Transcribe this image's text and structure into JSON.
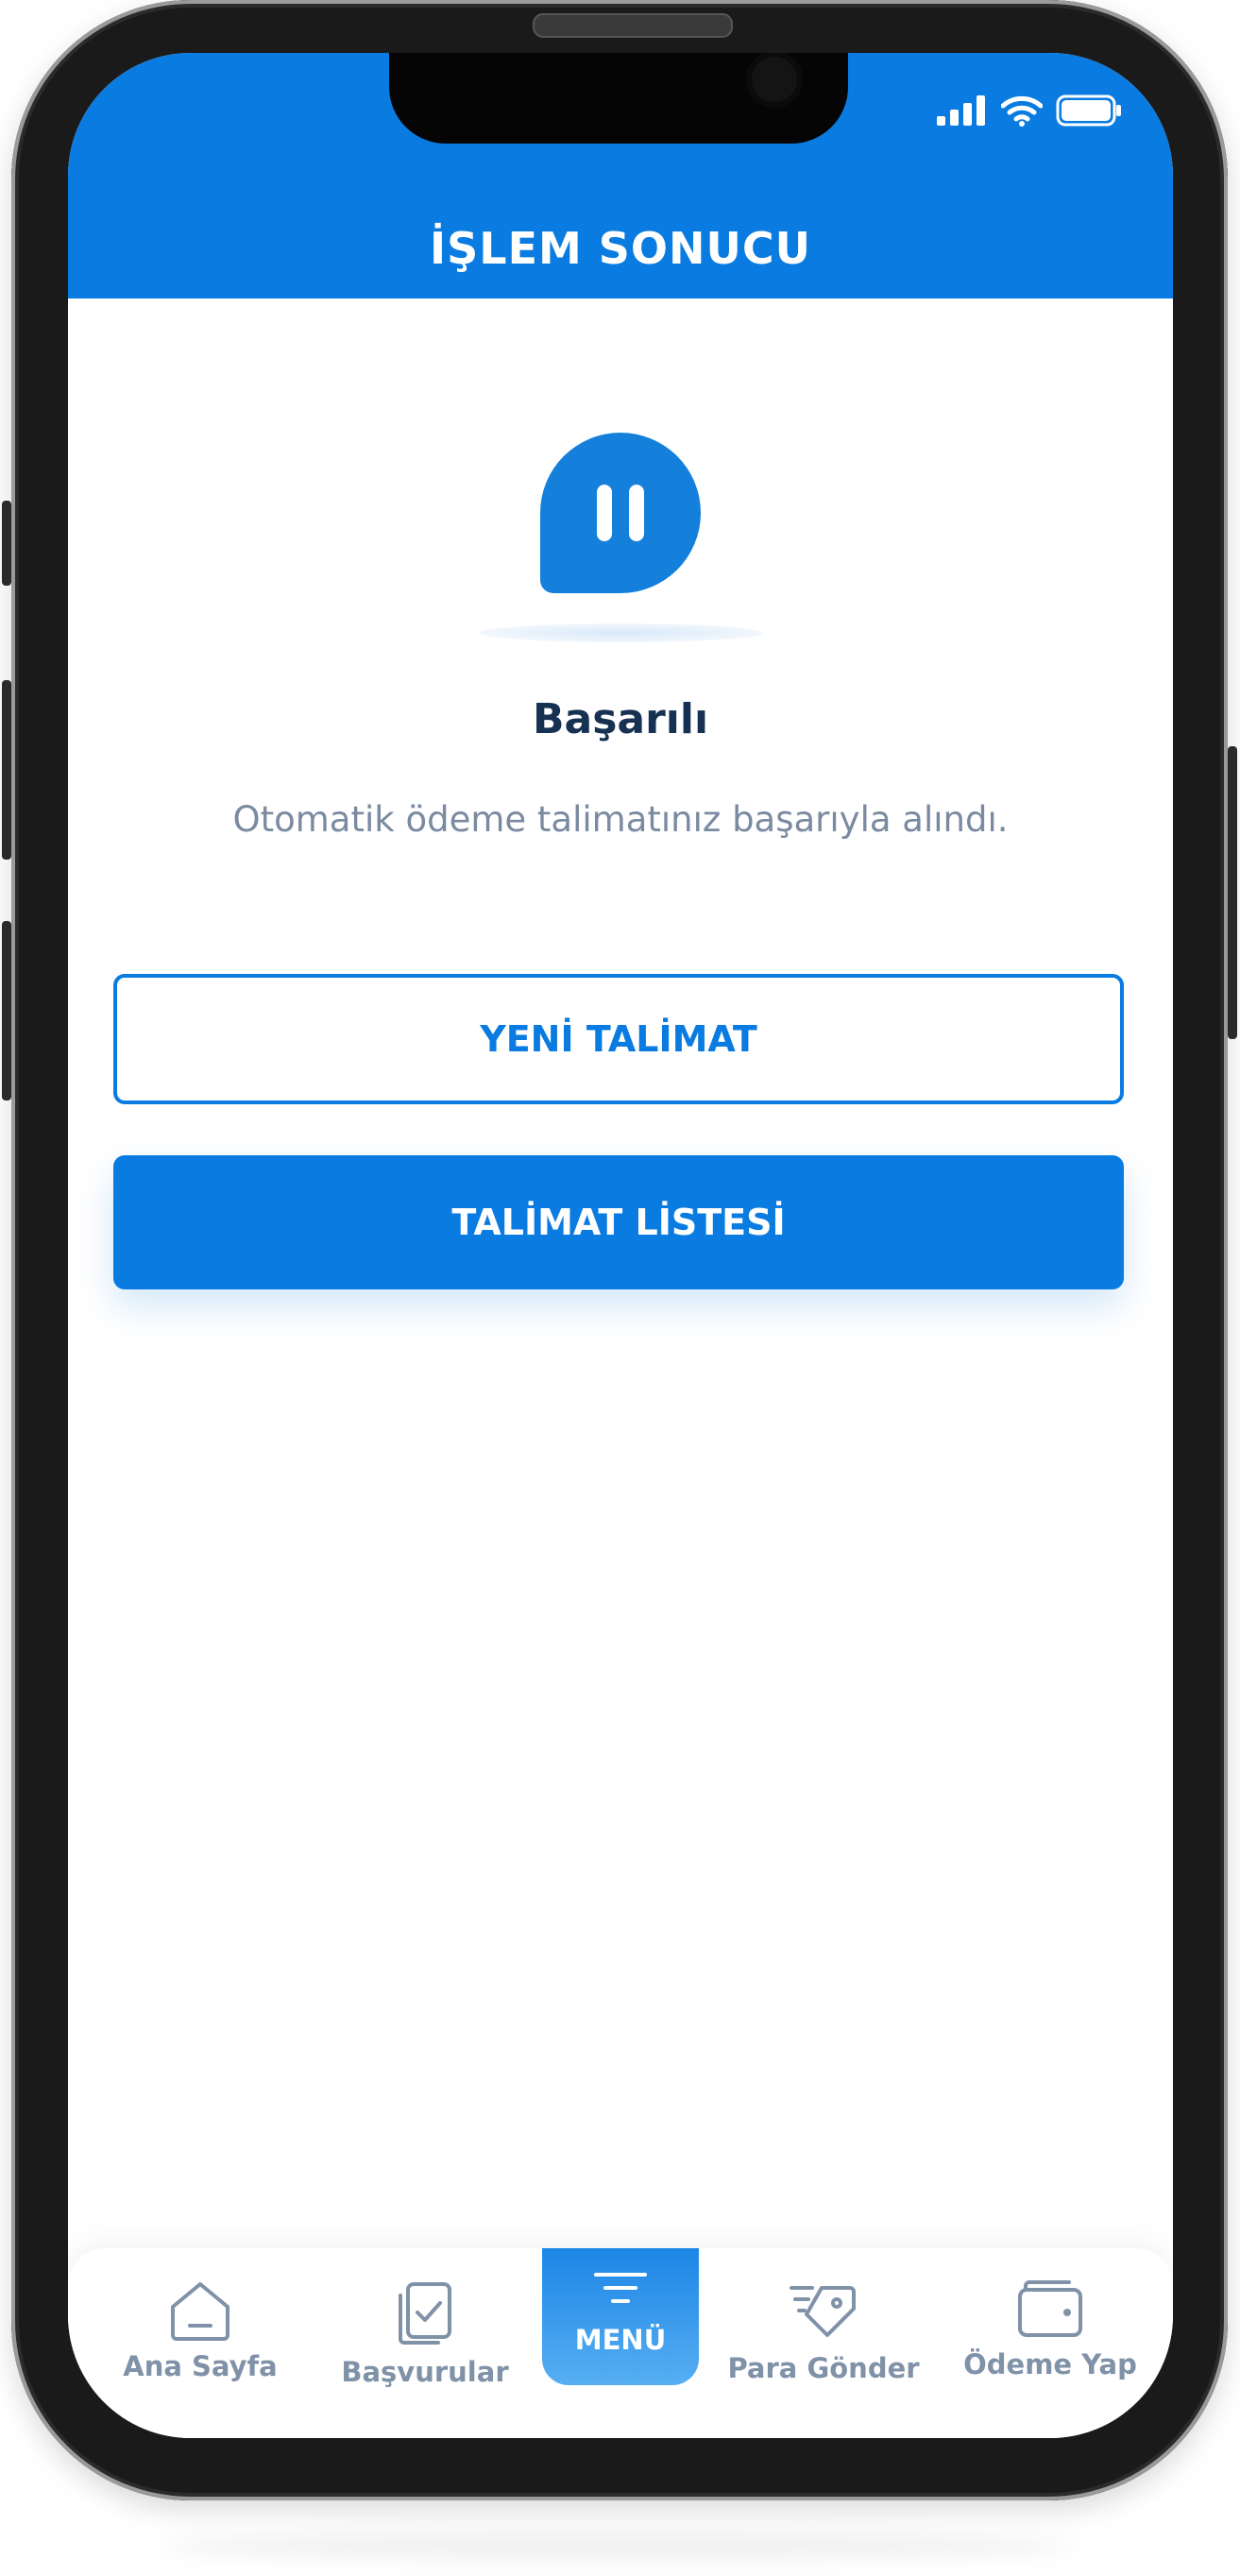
{
  "header": {
    "title": "İŞLEM SONUCU"
  },
  "result": {
    "title": "Başarılı",
    "message": "Otomatik ödeme talimatınız başarıyla alındı."
  },
  "actions": {
    "new_instruction": "YENİ TALİMAT",
    "instruction_list": "TALİMAT LİSTESİ"
  },
  "bottom_nav": {
    "items": [
      {
        "label": "Ana Sayfa",
        "icon": "home-icon"
      },
      {
        "label": "Başvurular",
        "icon": "applications-icon"
      },
      {
        "label": "MENÜ",
        "icon": "menu-icon"
      },
      {
        "label": "Para Gönder",
        "icon": "send-money-icon"
      },
      {
        "label": "Ödeme Yap",
        "icon": "wallet-icon"
      }
    ]
  },
  "colors": {
    "primary": "#0a7be0",
    "title_text": "#163152",
    "muted_text": "#7a8aa0",
    "nav_text": "#8092a8"
  }
}
